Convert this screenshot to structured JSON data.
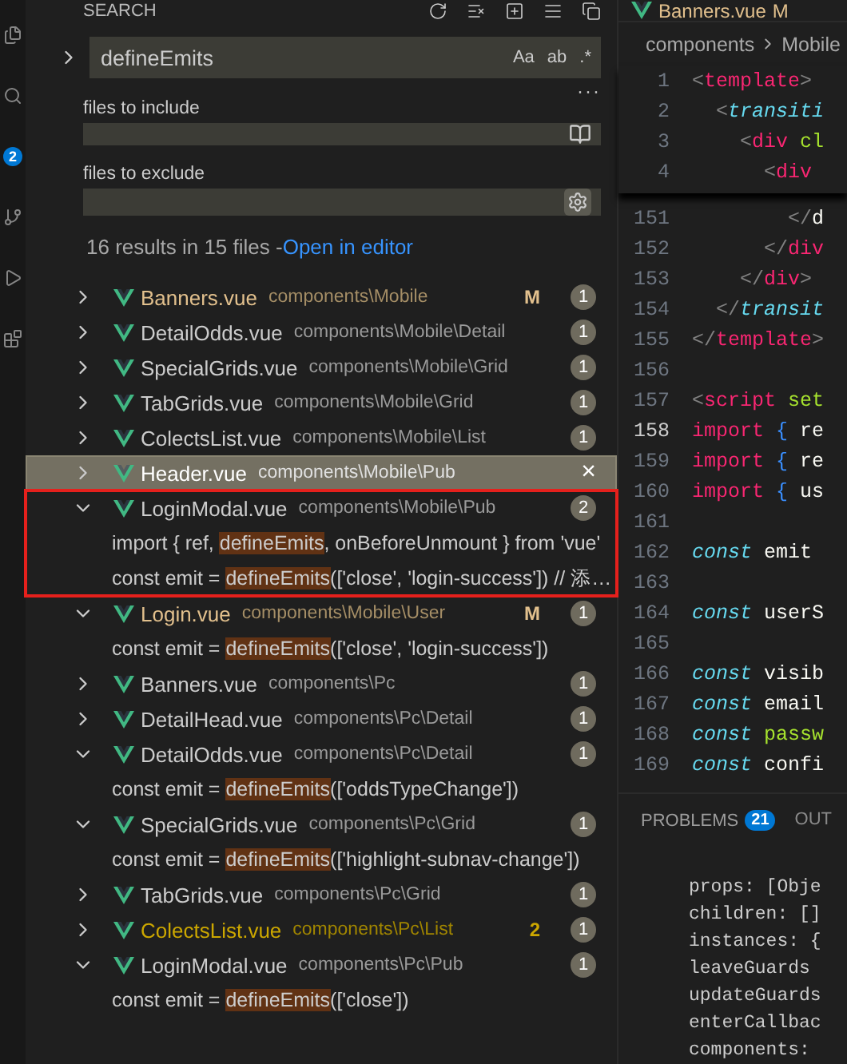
{
  "activity_bar": {
    "badge": "2"
  },
  "search_view": {
    "title": "SEARCH",
    "query": "defineEmits",
    "options": [
      "Aa",
      "ab",
      ".*"
    ],
    "more": "···",
    "include_label": "files to include",
    "exclude_label": "files to exclude",
    "summary": "16 results in 15 files - ",
    "open_link": "Open in editor"
  },
  "results": [
    {
      "name": "Banners.vue",
      "path": "components\\Mobile",
      "expanded": false,
      "selected": false,
      "outlined": false,
      "modified": true,
      "warning": false,
      "marker": "M",
      "count": "1"
    },
    {
      "name": "DetailOdds.vue",
      "path": "components\\Mobile\\Detail",
      "expanded": false,
      "selected": false,
      "outlined": false,
      "modified": false,
      "warning": false,
      "count": "1"
    },
    {
      "name": "SpecialGrids.vue",
      "path": "components\\Mobile\\Grid",
      "expanded": false,
      "selected": false,
      "outlined": false,
      "modified": false,
      "warning": false,
      "count": "1"
    },
    {
      "name": "TabGrids.vue",
      "path": "components\\Mobile\\Grid",
      "expanded": false,
      "selected": false,
      "outlined": false,
      "modified": false,
      "warning": false,
      "count": "1"
    },
    {
      "name": "ColectsList.vue",
      "path": "components\\Mobile\\List",
      "expanded": false,
      "selected": false,
      "outlined": false,
      "modified": false,
      "warning": false,
      "count": "1"
    },
    {
      "name": "Header.vue",
      "path": "components\\Mobile\\Pub",
      "expanded": false,
      "selected": true,
      "outlined": false,
      "modified": false,
      "warning": false,
      "close": "×"
    },
    {
      "name": "LoginModal.vue",
      "path": "components\\Mobile\\Pub",
      "expanded": true,
      "selected": false,
      "outlined": true,
      "modified": false,
      "warning": false,
      "count": "2",
      "children": [
        {
          "pre": "import { ref, ",
          "match": "defineEmits",
          "post": ", onBeforeUnmount } from 'vue'"
        },
        {
          "pre": "const emit = ",
          "match": "defineEmits",
          "post": "(['close', 'login-success']) // 添…"
        }
      ]
    },
    {
      "name": "Login.vue",
      "path": "components\\Mobile\\User",
      "expanded": true,
      "selected": false,
      "outlined": false,
      "modified": true,
      "warning": false,
      "marker": "M",
      "count": "1",
      "children": [
        {
          "pre": "const emit = ",
          "match": "defineEmits",
          "post": "(['close', 'login-success'])"
        }
      ]
    },
    {
      "name": "Banners.vue",
      "path": "components\\Pc",
      "expanded": false,
      "selected": false,
      "outlined": false,
      "modified": false,
      "warning": false,
      "count": "1"
    },
    {
      "name": "DetailHead.vue",
      "path": "components\\Pc\\Detail",
      "expanded": false,
      "selected": false,
      "outlined": false,
      "modified": false,
      "warning": false,
      "count": "1"
    },
    {
      "name": "DetailOdds.vue",
      "path": "components\\Pc\\Detail",
      "expanded": true,
      "selected": false,
      "outlined": false,
      "modified": false,
      "warning": false,
      "count": "1",
      "children": [
        {
          "pre": "const emit = ",
          "match": "defineEmits",
          "post": "(['oddsTypeChange'])"
        }
      ]
    },
    {
      "name": "SpecialGrids.vue",
      "path": "components\\Pc\\Grid",
      "expanded": true,
      "selected": false,
      "outlined": false,
      "modified": false,
      "warning": false,
      "count": "1",
      "children": [
        {
          "pre": "const emit = ",
          "match": "defineEmits",
          "post": "(['highlight-subnav-change'])"
        }
      ]
    },
    {
      "name": "TabGrids.vue",
      "path": "components\\Pc\\Grid",
      "expanded": false,
      "selected": false,
      "outlined": false,
      "modified": false,
      "warning": false,
      "count": "1"
    },
    {
      "name": "ColectsList.vue",
      "path": "components\\Pc\\List",
      "expanded": false,
      "selected": false,
      "outlined": false,
      "warning": true,
      "marker": "2",
      "count": "1"
    },
    {
      "name": "LoginModal.vue",
      "path": "components\\Pc\\Pub",
      "expanded": true,
      "selected": false,
      "outlined": false,
      "modified": false,
      "warning": false,
      "count": "1",
      "children": [
        {
          "pre": "const emit = ",
          "match": "defineEmits",
          "post": "(['close'])"
        }
      ]
    }
  ],
  "editor": {
    "tab": {
      "name": "Banners.vue",
      "marker": "M"
    },
    "breadcrumb": [
      "components",
      "Mobile"
    ],
    "sticky_lines": [
      {
        "number": "1",
        "tokens": [
          {
            "kind": "punct",
            "text": "<"
          },
          {
            "kind": "tag",
            "text": "template"
          },
          {
            "kind": "punct",
            "text": ">"
          }
        ]
      },
      {
        "number": "2",
        "tokens": [
          {
            "kind": "punct",
            "text": "  <"
          },
          {
            "kind": "tagi",
            "text": "transiti"
          }
        ]
      },
      {
        "number": "3",
        "tokens": [
          {
            "kind": "punct",
            "text": "    <"
          },
          {
            "kind": "tag",
            "text": "div"
          },
          {
            "kind": "attr",
            "text": " cl"
          }
        ]
      },
      {
        "number": "4",
        "tokens": [
          {
            "kind": "punct",
            "text": "      <"
          },
          {
            "kind": "tag",
            "text": "div"
          }
        ]
      }
    ],
    "lines": [
      {
        "number": "151",
        "current": false,
        "tokens": [
          {
            "kind": "punct",
            "text": "        </"
          },
          {
            "kind": "text",
            "text": "d"
          }
        ]
      },
      {
        "number": "152",
        "current": false,
        "tokens": [
          {
            "kind": "punct",
            "text": "      </"
          },
          {
            "kind": "tag",
            "text": "div"
          }
        ]
      },
      {
        "number": "153",
        "current": false,
        "tokens": [
          {
            "kind": "punct",
            "text": "    </"
          },
          {
            "kind": "tag",
            "text": "div"
          },
          {
            "kind": "punct",
            "text": ">"
          }
        ]
      },
      {
        "number": "154",
        "current": false,
        "tokens": [
          {
            "kind": "punct",
            "text": "  </"
          },
          {
            "kind": "tagi",
            "text": "transit"
          }
        ]
      },
      {
        "number": "155",
        "current": false,
        "tokens": [
          {
            "kind": "punct",
            "text": "</"
          },
          {
            "kind": "tag",
            "text": "template"
          },
          {
            "kind": "punct",
            "text": ">"
          }
        ]
      },
      {
        "number": "156",
        "current": false
      },
      {
        "number": "157",
        "current": false,
        "tokens": [
          {
            "kind": "punct",
            "text": "<"
          },
          {
            "kind": "tag",
            "text": "script"
          },
          {
            "kind": "attr",
            "text": " set"
          }
        ]
      },
      {
        "number": "158",
        "current": true,
        "tokens": [
          {
            "kind": "keyword",
            "text": "import"
          },
          {
            "kind": "brace",
            "text": " {"
          },
          {
            "kind": "text",
            "text": " re"
          }
        ]
      },
      {
        "number": "159",
        "current": false,
        "tokens": [
          {
            "kind": "keyword",
            "text": "import"
          },
          {
            "kind": "brace",
            "text": " {"
          },
          {
            "kind": "text",
            "text": " re"
          }
        ]
      },
      {
        "number": "160",
        "current": false,
        "tokens": [
          {
            "kind": "keyword",
            "text": "import"
          },
          {
            "kind": "brace",
            "text": " {"
          },
          {
            "kind": "text",
            "text": " us"
          }
        ]
      },
      {
        "number": "161",
        "current": false
      },
      {
        "number": "162",
        "current": false,
        "tokens": [
          {
            "kind": "storage",
            "text": "const"
          },
          {
            "kind": "text",
            "text": " emit"
          }
        ]
      },
      {
        "number": "163",
        "current": false
      },
      {
        "number": "164",
        "current": false,
        "tokens": [
          {
            "kind": "storage",
            "text": "const"
          },
          {
            "kind": "text",
            "text": " userS"
          }
        ]
      },
      {
        "number": "165",
        "current": false
      },
      {
        "number": "166",
        "current": false,
        "tokens": [
          {
            "kind": "storage",
            "text": "const"
          },
          {
            "kind": "text",
            "text": " visib"
          }
        ]
      },
      {
        "number": "167",
        "current": false,
        "tokens": [
          {
            "kind": "storage",
            "text": "const"
          },
          {
            "kind": "text",
            "text": " email"
          }
        ]
      },
      {
        "number": "168",
        "current": false,
        "tokens": [
          {
            "kind": "storage",
            "text": "const"
          },
          {
            "kind": "attr",
            "text": " passw"
          }
        ]
      },
      {
        "number": "169",
        "current": false,
        "tokens": [
          {
            "kind": "storage",
            "text": "const"
          },
          {
            "kind": "text",
            "text": " confi"
          }
        ]
      }
    ]
  },
  "panel": {
    "tabs": [
      {
        "label": "PROBLEMS",
        "badge": "21",
        "selected": true
      },
      {
        "label": "OUT",
        "selected": false
      }
    ],
    "lines": [
      "props: [Obje",
      "children: []",
      "instances: {",
      "leaveGuards",
      "updateGuards",
      "enterCallbac",
      "components:"
    ]
  }
}
